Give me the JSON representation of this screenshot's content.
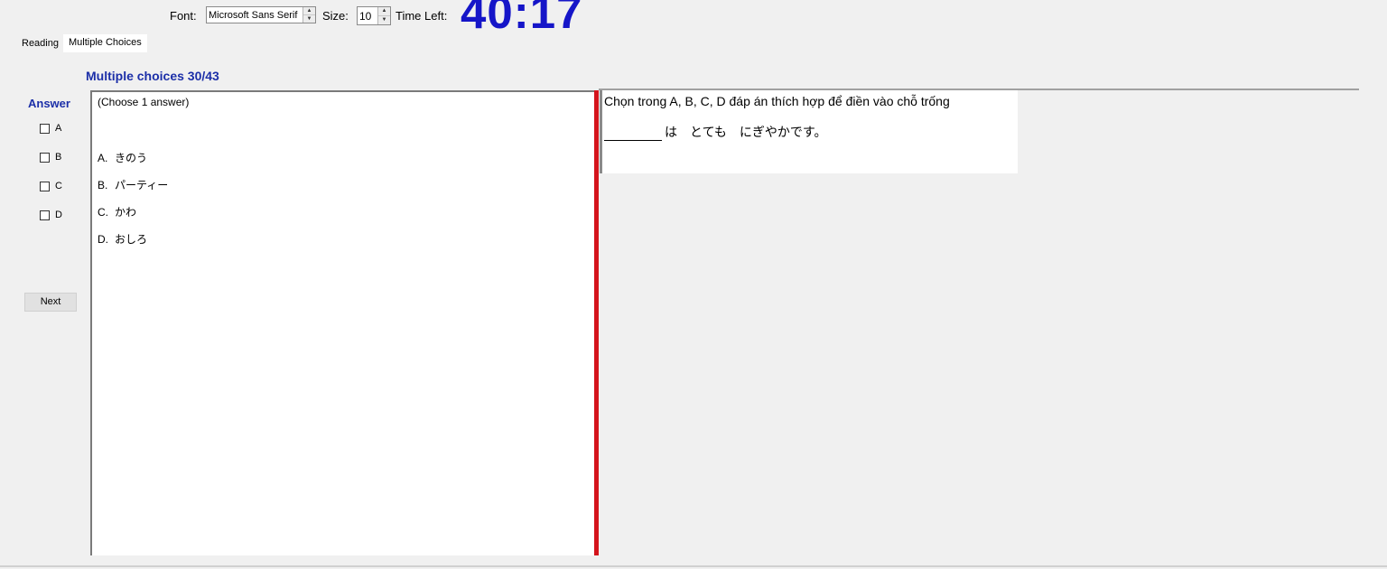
{
  "toolbar": {
    "font_label": "Font:",
    "font_value": "Microsoft Sans Serif",
    "size_label": "Size:",
    "size_value": "10",
    "time_label": "Time Left:",
    "timer": "40:17"
  },
  "tabs": [
    {
      "label": "Reading"
    },
    {
      "label": "Multiple Choices"
    }
  ],
  "section_title": "Multiple choices 30/43",
  "answer": {
    "label": "Answer",
    "options": [
      "A",
      "B",
      "C",
      "D"
    ]
  },
  "next_label": "Next",
  "left_panel": {
    "instruction": "(Choose 1 answer)",
    "options": [
      {
        "letter": "A.",
        "text": "きのう"
      },
      {
        "letter": "B.",
        "text": "パーティー"
      },
      {
        "letter": "C.",
        "text": "かわ"
      },
      {
        "letter": "D.",
        "text": "おしろ"
      }
    ]
  },
  "question": {
    "prompt": "Chọn trong A, B, C, D đáp án thích hợp để điền vào chỗ trống",
    "sentence": "は　とても　にぎやかです。"
  },
  "colors": {
    "timer": "#1515c8",
    "title": "#1c2fa8",
    "splitter": "#d4141c"
  }
}
